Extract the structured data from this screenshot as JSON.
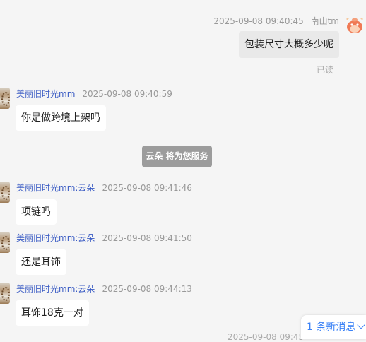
{
  "self": {
    "timestamp": "2025-09-08 09:40:45",
    "name": "南山tm",
    "message": "包装尺寸大概多少呢",
    "read_status": "已读"
  },
  "messages": [
    {
      "sender": "美丽旧时光mm",
      "timestamp": "2025-09-08 09:40:59",
      "text": "你是做跨境上架吗"
    },
    {
      "sender": "美丽旧时光mm:云朵",
      "timestamp": "2025-09-08 09:41:46",
      "text": "项链吗"
    },
    {
      "sender": "美丽旧时光mm:云朵",
      "timestamp": "2025-09-08 09:41:50",
      "text": "还是耳饰"
    },
    {
      "sender": "美丽旧时光mm:云朵",
      "timestamp": "2025-09-08 09:44:13",
      "text": "耳饰18克一对"
    }
  ],
  "system_notice": "云朵 将为您服务",
  "new_messages_label": "1 条新消息",
  "next_timestamp_peek": "2025-09-08 09:45",
  "colors": {
    "name": "#3b5cc4",
    "link": "#3b82f6",
    "background": "#f5f5f5"
  }
}
